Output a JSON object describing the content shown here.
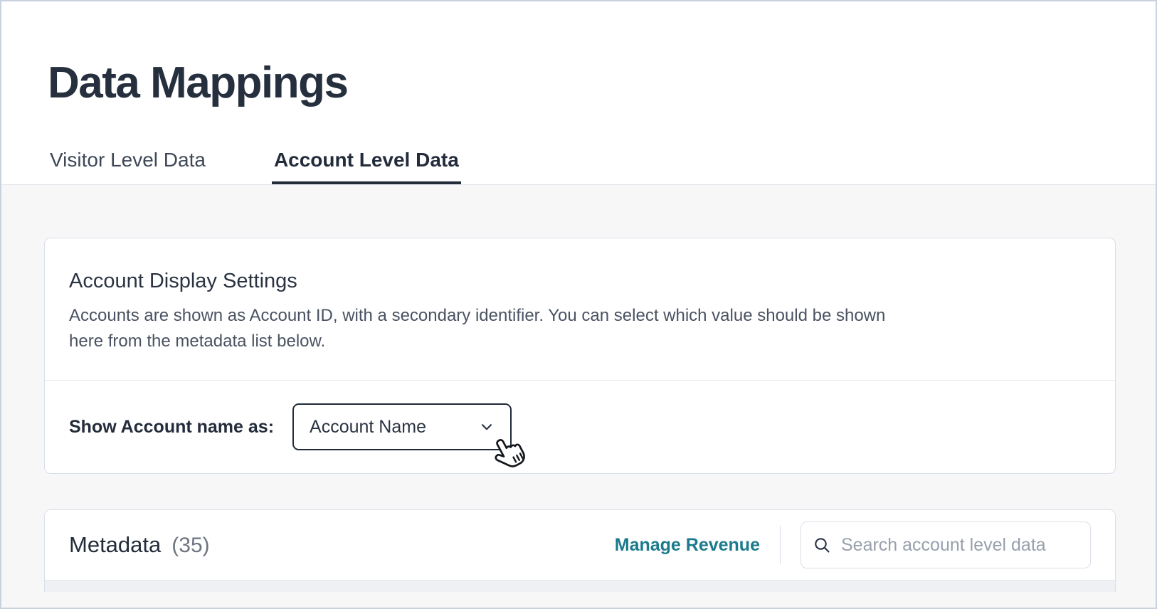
{
  "page": {
    "title": "Data Mappings"
  },
  "tabs": [
    {
      "label": "Visitor Level Data",
      "active": false
    },
    {
      "label": "Account Level Data",
      "active": true
    }
  ],
  "display_settings_card": {
    "heading": "Account Display Settings",
    "description_lines": [
      "Accounts are shown as Account ID, with a secondary identifier. You can select which value should be shown",
      "here from the metadata list below."
    ],
    "show_account_label": "Show Account name as:",
    "dropdown_value": "Account Name"
  },
  "metadata_section": {
    "heading": "Metadata",
    "count": "(35)",
    "manage_revenue_label": "Manage Revenue",
    "search_placeholder": "Search account level data"
  },
  "icons": {
    "dropdown_chevron": "chevron-down",
    "search": "magnifier",
    "cursor": "hand-pointer-click"
  },
  "colors": {
    "accent_teal": "#1b7a8c",
    "dark_text": "#262f3e",
    "body_text": "#4a5261",
    "page_background": "#f7f7f8",
    "card_border": "#d9dfe8",
    "tab_underline": "#232c3b",
    "placeholder_text": "#98a0ad"
  }
}
